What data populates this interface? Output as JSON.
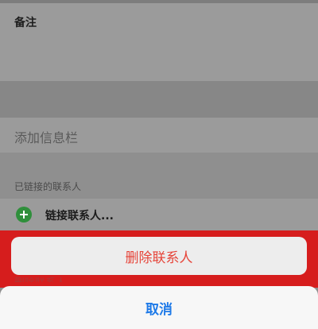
{
  "contact": {
    "notes_label": "备注",
    "add_field_label": "添加信息栏",
    "linked_section_header": "已链接的联系人",
    "link_contact_label": "链接联系人...",
    "partial_delete_text": "删除联系人"
  },
  "action_sheet": {
    "delete_label": "删除联系人",
    "cancel_label": "取消"
  },
  "colors": {
    "delete_text": "#e6453a",
    "cancel_text": "#1e7ae8",
    "highlight": "#d61d1d",
    "add_icon": "#2f8f3b"
  },
  "icons": {
    "link_add": "plus-circle-icon"
  }
}
